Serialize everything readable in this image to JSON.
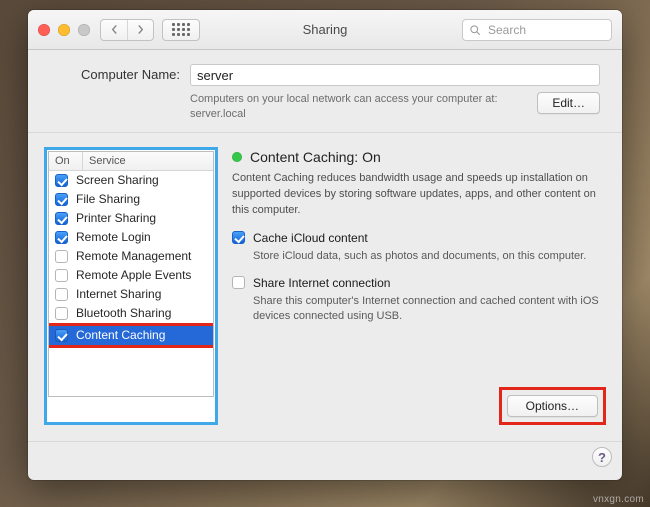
{
  "window": {
    "title": "Sharing",
    "search_placeholder": "Search"
  },
  "header": {
    "label": "Computer Name:",
    "value": "server",
    "hint_line1": "Computers on your local network can access your computer at:",
    "hint_line2": "server.local",
    "edit_button": "Edit…"
  },
  "list": {
    "col_on": "On",
    "col_svc": "Service",
    "items": [
      {
        "checked": true,
        "label": "Screen Sharing",
        "selected": false
      },
      {
        "checked": true,
        "label": "File Sharing",
        "selected": false
      },
      {
        "checked": true,
        "label": "Printer Sharing",
        "selected": false
      },
      {
        "checked": true,
        "label": "Remote Login",
        "selected": false
      },
      {
        "checked": false,
        "label": "Remote Management",
        "selected": false
      },
      {
        "checked": false,
        "label": "Remote Apple Events",
        "selected": false
      },
      {
        "checked": false,
        "label": "Internet Sharing",
        "selected": false
      },
      {
        "checked": false,
        "label": "Bluetooth Sharing",
        "selected": false
      },
      {
        "checked": true,
        "label": "Content Caching",
        "selected": true
      }
    ]
  },
  "pane": {
    "status": "Content Caching: On",
    "desc": "Content Caching reduces bandwidth usage and speeds up installation on supported devices by storing software updates, apps, and other content on this computer.",
    "opt1_title": "Cache iCloud content",
    "opt1_sub": "Store iCloud data, such as photos and documents, on this computer.",
    "opt1_checked": true,
    "opt2_title": "Share Internet connection",
    "opt2_sub": "Share this computer's Internet connection and cached content with iOS devices connected using USB.",
    "opt2_checked": false,
    "options_button": "Options…"
  },
  "help": "?",
  "watermark": "vnxgn.com"
}
